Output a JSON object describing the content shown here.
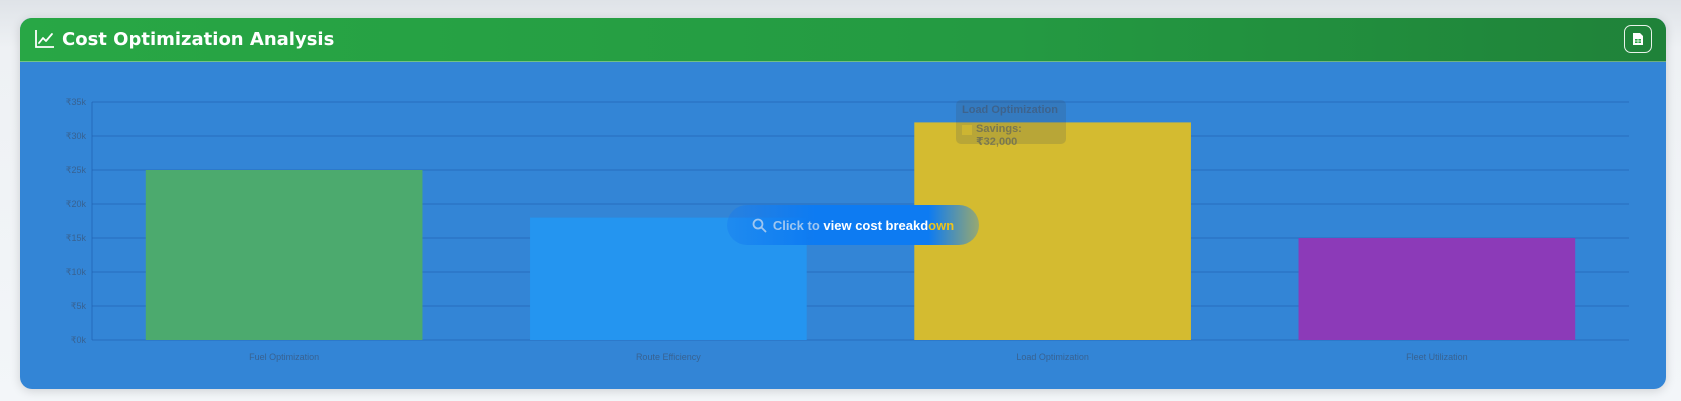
{
  "header": {
    "title": "Cost Optimization Analysis",
    "chart_icon": "line-chart-icon",
    "export_icon": "spreadsheet-icon"
  },
  "overlay": {
    "icon": "search-icon",
    "text_pre": "Click to",
    "text_mid": " view cost breakd",
    "text_post": "own"
  },
  "tooltip": {
    "title": "Load Optimization",
    "value": "Savings: ₹32,000"
  },
  "colors": {
    "header": "#28a745",
    "panel": "#3385d6",
    "fuel": "#4caa6e",
    "route": "#2495f0",
    "load": "#d4bb30",
    "fleet": "#8c3ab8"
  },
  "chart_data": {
    "type": "bar",
    "categories": [
      "Fuel Optimization",
      "Route Efficiency",
      "Load Optimization",
      "Fleet Utilization"
    ],
    "values": [
      25000,
      18000,
      32000,
      15000
    ],
    "bar_colors": [
      "#4caa6e",
      "#2495f0",
      "#d4bb30",
      "#8c3ab8"
    ],
    "yticks": [
      "₹0k",
      "₹5k",
      "₹10k",
      "₹15k",
      "₹20k",
      "₹25k",
      "₹30k",
      "₹35k"
    ],
    "ylim": [
      0,
      35000
    ],
    "grid": true,
    "legend": "none"
  }
}
